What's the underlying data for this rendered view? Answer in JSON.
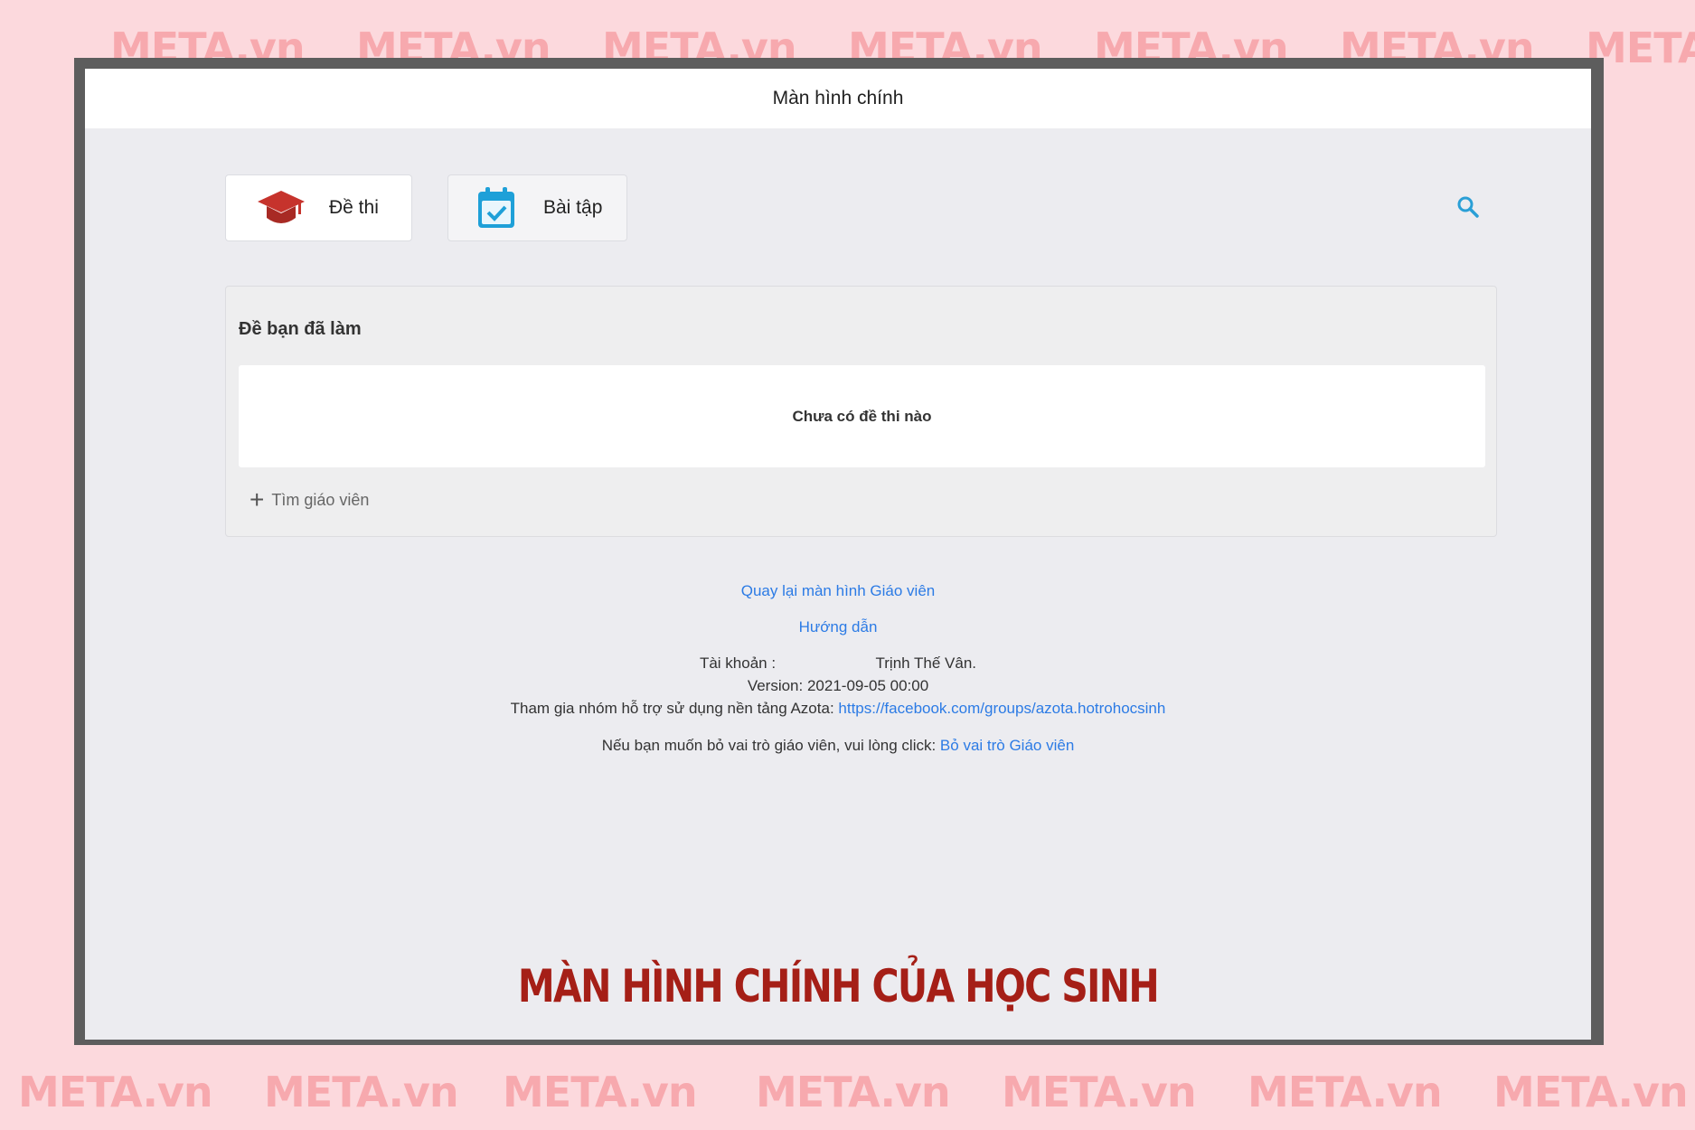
{
  "watermark": "META.vn",
  "header": {
    "title": "Màn hình chính"
  },
  "tabs": {
    "exam": {
      "label": "Đề thi",
      "icon": "graduation-cap-icon",
      "color": "#c6332c"
    },
    "homework": {
      "label": "Bài tập",
      "icon": "calendar-check-icon",
      "color": "#1ea0d8"
    }
  },
  "search": {
    "icon": "search-icon",
    "color": "#2a9fd6"
  },
  "done_panel": {
    "title": "Đề bạn đã làm",
    "empty_text": "Chưa có đề thi nào",
    "find_teacher": "Tìm giáo viên"
  },
  "footer": {
    "back_link": "Quay lại màn hình Giáo viên",
    "guide_link": "Hướng dẫn",
    "account_label": "Tài khoản :",
    "account_name": "Trịnh Thế Vân.",
    "version": "Version: 2021-09-05 00:00",
    "group_text": "Tham gia nhóm hỗ trợ sử dụng nền tảng Azota:",
    "group_link": "https://facebook.com/groups/azota.hotrohocsinh",
    "role_text": "Nếu bạn muốn bỏ vai trò giáo viên, vui lòng click:",
    "role_link": "Bỏ vai trò Giáo viên"
  },
  "caption": "MÀN HÌNH CHÍNH CỦA HỌC SINH"
}
